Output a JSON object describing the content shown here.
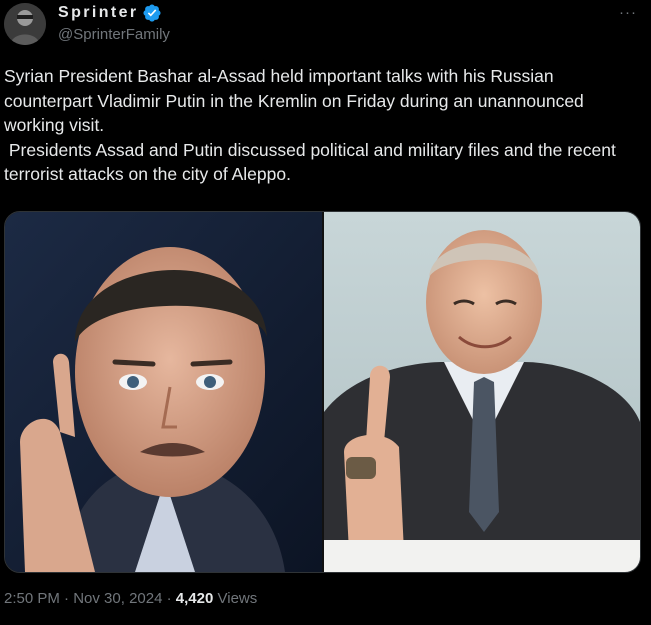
{
  "author": {
    "display_name": "Sprinter",
    "handle": "@SprinterFamily",
    "verified_icon": "verified-badge-icon",
    "badge_color": "#1d9bf0"
  },
  "more_label": "···",
  "tweet": {
    "paragraph_1": "Syrian President Bashar al-Assad held important talks with his Russian counterpart Vladimir Putin in the Kremlin on Friday during an unannounced working visit.",
    "paragraph_2": " Presidents Assad and Putin discussed political and military files and the recent terrorist attacks on the city of Aleppo."
  },
  "media": {
    "images": [
      {
        "name": "assad-portrait"
      },
      {
        "name": "putin-thumbs-up"
      }
    ]
  },
  "meta": {
    "time": "2:50 PM",
    "separator_1": " · ",
    "date": "Nov 30, 2024",
    "separator_2": " · ",
    "views_count": "4,420",
    "views_label": " Views"
  },
  "colors": {
    "background": "#000000",
    "text": "#e7e9ea",
    "muted": "#71767b",
    "accent": "#1d9bf0"
  }
}
